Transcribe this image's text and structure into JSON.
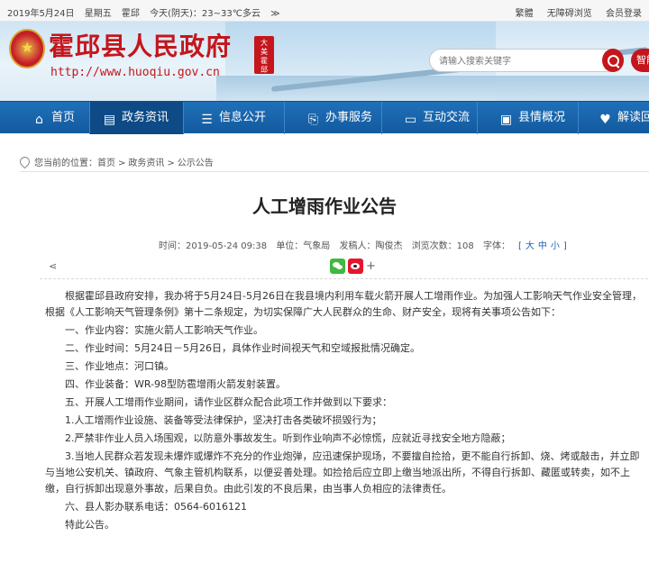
{
  "topbar": {
    "date": "2019年5月24日",
    "weekday": "星期五",
    "location": "霍邱",
    "weather": "今天(阴天)：23~33℃多云",
    "weather_more": "≫",
    "links": [
      "繁體",
      "无障碍浏览",
      "会员登录"
    ]
  },
  "header": {
    "site_name": "霍邱县人民政府",
    "site_url": "http://www.huoqiu.gov.cn",
    "seal_text": "大美霍邱",
    "search_placeholder": "请输入搜索关键字",
    "smart_label": "智能"
  },
  "nav": {
    "items": [
      {
        "label": "首页",
        "icon": "home-icon"
      },
      {
        "label": "政务资讯",
        "icon": "news-icon"
      },
      {
        "label": "信息公开",
        "icon": "document-icon"
      },
      {
        "label": "办事服务",
        "icon": "service-icon"
      },
      {
        "label": "互动交流",
        "icon": "monitor-icon"
      },
      {
        "label": "县情概况",
        "icon": "list-icon"
      },
      {
        "label": "解读回应",
        "icon": "thumbs-up-icon"
      }
    ],
    "active_index": 1
  },
  "breadcrumb": {
    "prefix": "您当前的位置：",
    "items": [
      "首页",
      "政务资讯",
      "公示公告"
    ],
    "separator": ">"
  },
  "article": {
    "title": "人工增雨作业公告",
    "meta": {
      "time_label": "时间：2019-05-24 09:38",
      "unit_label": "单位：气象局",
      "publisher_label": "发稿人：陶俊杰",
      "views_label": "浏览次数：108",
      "fontsize_label": "字体：",
      "fontsize_options": [
        "[",
        "大",
        "中",
        "小",
        "]"
      ]
    },
    "paragraphs": [
      "根据霍邱县政府安排，我办将于5月24日-5月26日在我县境内利用车载火箭开展人工增雨作业。为加强人工影响天气作业安全管理，根据《人工影响天气管理条例》第十二条规定，为切实保障广大人民群众的生命、财产安全，现将有关事项公告如下：",
      "一、作业内容：实施火箭人工影响天气作业。",
      "二、作业时间：5月24日－5月26日，具体作业时间视天气和空域报批情况确定。",
      "三、作业地点：河口镇。",
      "四、作业装备：WR-98型防雹增雨火箭发射装置。",
      "五、开展人工增雨作业期间，请作业区群众配合此项工作并做到以下要求：",
      "1.人工增雨作业设施、装备等受法律保护，坚决打击各类破坏损毁行为；",
      "2.严禁非作业人员入场围观，以防意外事故发生。听到作业响声不必惊慌，应就近寻找安全地方隐蔽；",
      "3.当地人民群众若发现未爆炸或爆炸不充分的作业炮弹，应迅速保护现场，不要擅自捡拾，更不能自行拆卸、烧、烤或敲击，并立即与当地公安机关、镇政府、气象主管机构联系，以便妥善处理。如捡拾后应立即上缴当地派出所，不得自行拆卸、藏匿或转卖，如不上缴，自行拆卸出现意外事故，后果自负。由此引发的不良后果，由当事人负相应的法律责任。",
      "六、县人影办联系电话：0564-6016121",
      "特此公告。"
    ]
  }
}
